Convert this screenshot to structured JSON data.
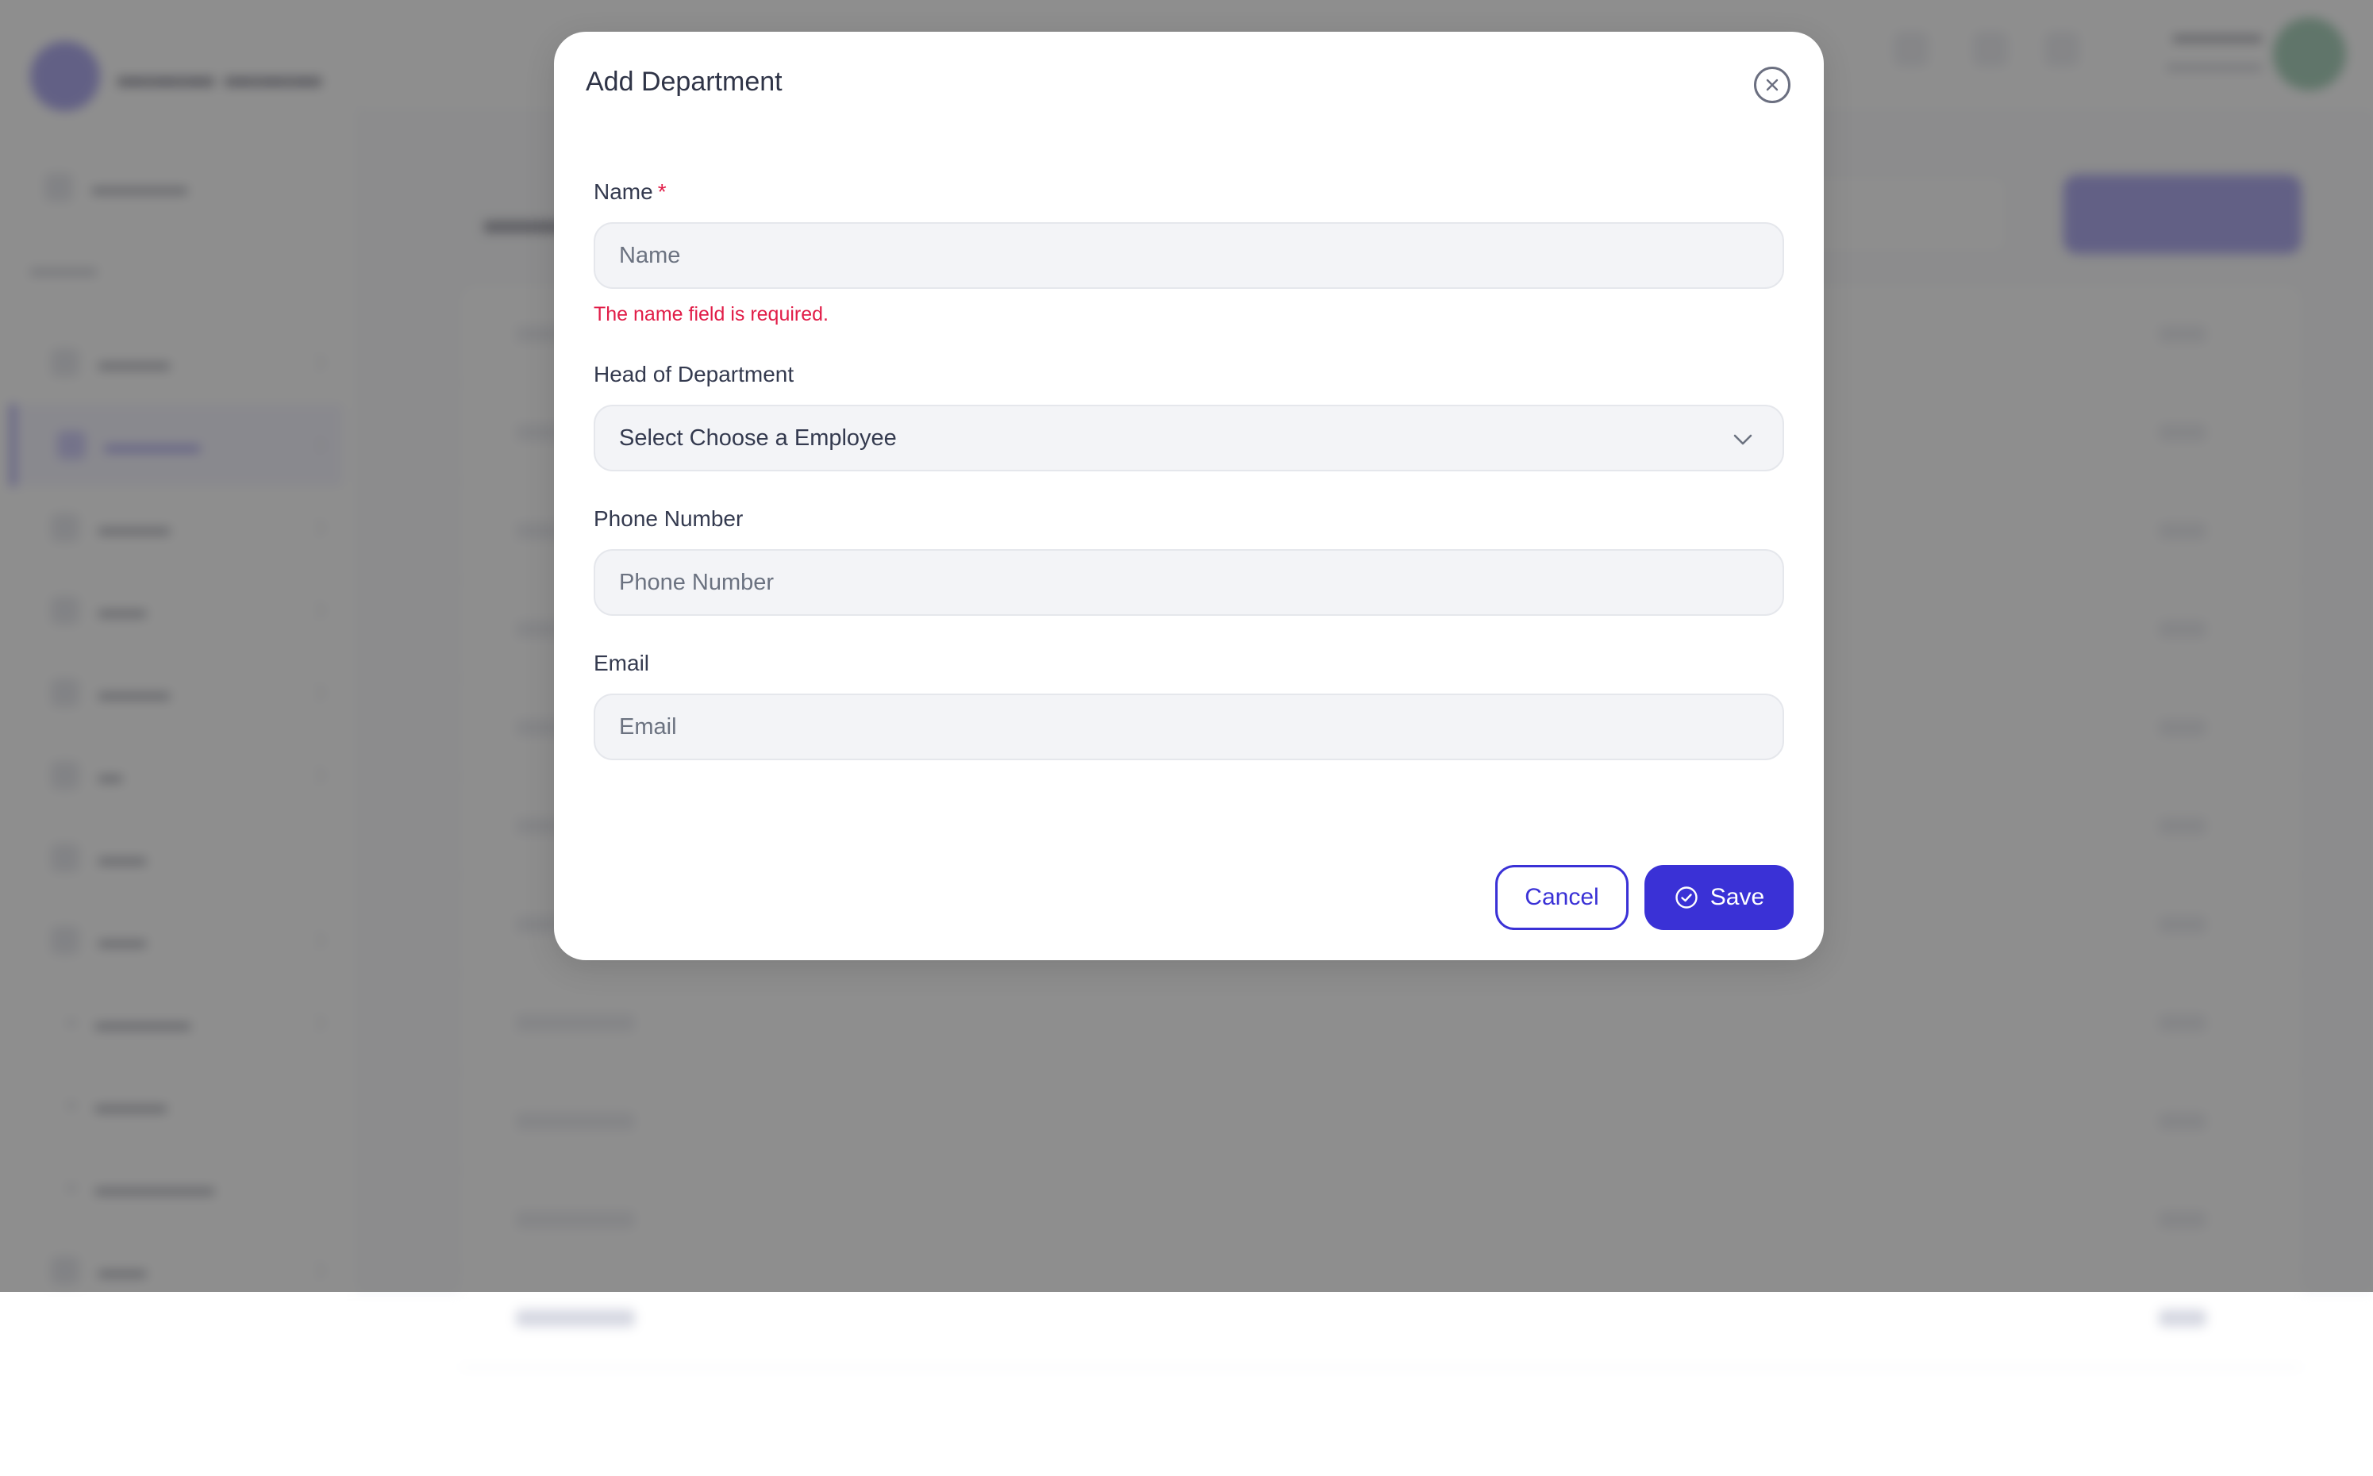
{
  "modal": {
    "title": "Add Department",
    "fields": {
      "name": {
        "label": "Name",
        "required_mark": "*",
        "placeholder": "Name",
        "value": "",
        "error": "The name field is required."
      },
      "head": {
        "label": "Head of Department",
        "selected": "Select Choose a Employee"
      },
      "phone": {
        "label": "Phone Number",
        "placeholder": "Phone Number",
        "value": ""
      },
      "email": {
        "label": "Email",
        "placeholder": "Email",
        "value": ""
      }
    },
    "buttons": {
      "cancel": "Cancel",
      "save": "Save"
    }
  },
  "icons": {
    "close": "close-circle-icon",
    "dropdown": "chevron-down-icon",
    "save": "check-circle-icon"
  },
  "colors": {
    "primary": "#3a31d6",
    "error": "#e11d48",
    "overlay": "rgba(110,110,110,0.78)"
  }
}
